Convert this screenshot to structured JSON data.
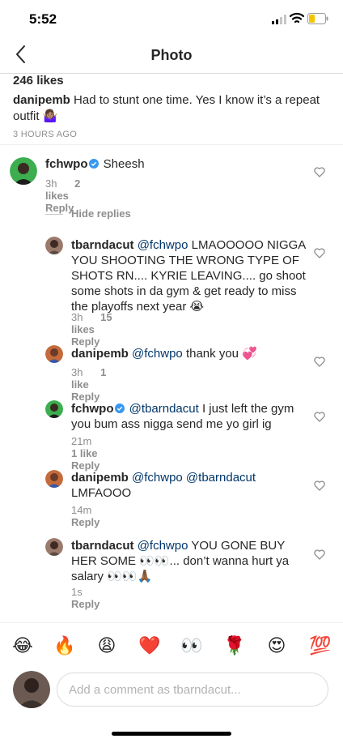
{
  "status": {
    "time": "5:52"
  },
  "nav": {
    "title": "Photo"
  },
  "post": {
    "likes": "246 likes",
    "caption_user": "danipemb",
    "caption_text": "Had to stunt one time. Yes I know it’s a repeat outfit 🤷🏽‍♀️",
    "time": "3 HOURS AGO"
  },
  "comments": {
    "main": {
      "user": "fchwpo",
      "text": "Sheesh",
      "time": "3h",
      "likes": "2 likes",
      "reply": "Reply"
    },
    "hide_replies": "Hide replies",
    "replies": [
      {
        "user": "tbarndacut",
        "mention": "@fchwpo",
        "text": "LMAOOOOO NIGGA YOU SHOOTING THE WRONG TYPE OF SHOTS RN.... KYRIE LEAVING.... go shoot some shots in da gym & get ready to miss the playoffs next year 😭",
        "time": "3h",
        "likes": "15 likes",
        "reply": "Reply"
      },
      {
        "user": "danipemb",
        "mention": "@fchwpo",
        "text": "thank you 💞",
        "time": "3h",
        "likes": "1 like",
        "reply": "Reply"
      },
      {
        "user": "fchwpo",
        "mention": "@tbarndacut",
        "text": "I just left the gym you bum ass nigga send me yo girl ig",
        "time": "21m",
        "likes": "1 like",
        "reply": "Reply"
      },
      {
        "user": "danipemb",
        "mention": "@fchwpo @tbarndacut",
        "text": "LMFAOOO",
        "time": "14m",
        "likes": "",
        "reply": "Reply"
      },
      {
        "user": "tbarndacut",
        "mention": "@fchwpo",
        "text": "YOU GONE BUY HER SOME 👀👀... don’t wanna hurt ya salary 👀👀🙏🏾",
        "time": "1s",
        "likes": "",
        "reply": "Reply"
      }
    ]
  },
  "emoji_bar": [
    "😂",
    "🔥",
    "😩",
    "❤️",
    "👀",
    "🌹",
    "😍",
    "💯"
  ],
  "input": {
    "placeholder": "Add a comment as tbarndacut..."
  },
  "colors": {
    "verified": "#3897f0",
    "mention": "#003569",
    "muted": "#8e8e8e",
    "border": "#dbdbdb"
  }
}
